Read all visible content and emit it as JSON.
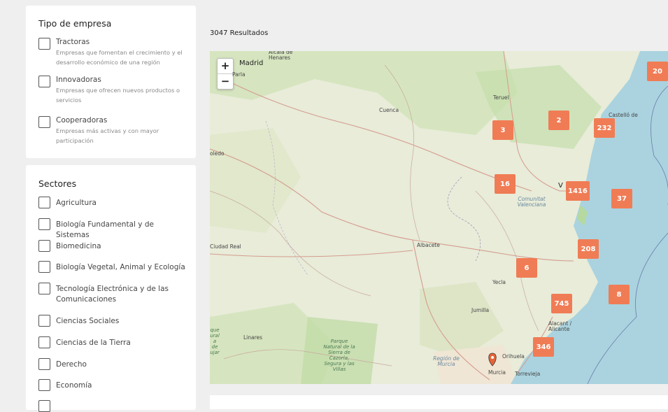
{
  "tipo_empresa": {
    "title": "Tipo de empresa",
    "items": [
      {
        "label": "Tractoras",
        "desc": "Empresas que fomentan el crecimiento y el desarrollo económico de una región"
      },
      {
        "label": "Innovadoras",
        "desc": "Empresas que ofrecen nuevos productos o servicios"
      },
      {
        "label": "Cooperadoras",
        "desc": "Empresas más activas y con mayor participación"
      }
    ]
  },
  "sectores": {
    "title": "Sectores",
    "items": [
      "Agricultura",
      "Biología Fundamental y de Sistemas",
      "Biomedicina",
      "Biología Vegetal, Animal y Ecología",
      "Tecnología Electrónica y de las Comunicaciones",
      "Ciencias Sociales",
      "Ciencias de la Tierra",
      "Derecho",
      "Economía"
    ]
  },
  "results": {
    "count_label": "3047 Resultados"
  },
  "map": {
    "zoom_in": "+",
    "zoom_out": "−",
    "clusters": [
      "20",
      "2",
      "232",
      "3",
      "16",
      "1416",
      "37",
      "208",
      "6",
      "745",
      "8",
      "346"
    ],
    "places": {
      "madrid": "Madrid",
      "alcala": "Alcalá de Henares",
      "parla": "Parla",
      "teruel": "Teruel",
      "cuenca": "Cuenca",
      "castellon": "Castelló de",
      "valencia": "V",
      "comunitat": "Comunitat Valenciana",
      "albacete": "Albacete",
      "ciudad_real": "Ciudad Real",
      "yecla": "Yecla",
      "jumilla": "Jumilla",
      "alacant": "Alacant / Alicante",
      "orihuela": "Orihuela",
      "murcia": "Murcia",
      "region_murcia": "Región de Murcia",
      "torrevieja": "Torrevieja",
      "linares": "Linares",
      "parque_cazorla": "Parque Natural de la Sierra de Cazorla, Segura y las Villas",
      "toledo": "oledo",
      "parque_left": "que ural a de ujar"
    },
    "colors": {
      "cluster": "#f07c55",
      "sea": "#aad3df",
      "land": "#e8ecd9"
    }
  }
}
